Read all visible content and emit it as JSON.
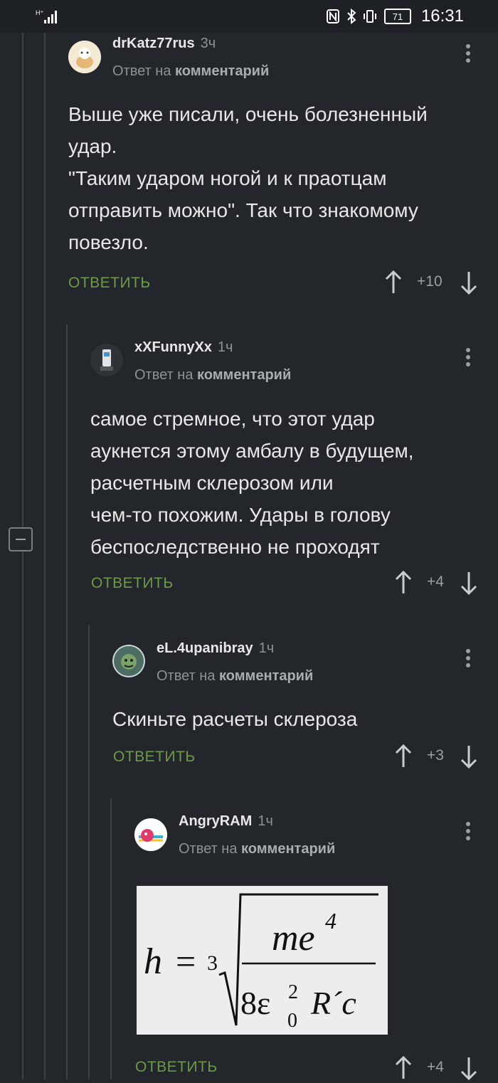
{
  "status_bar": {
    "time": "16:31",
    "battery": "71",
    "network": "H⁺"
  },
  "comments": [
    {
      "username": "drKatz77rus",
      "time": "3ч",
      "reply_prefix": "Ответ на",
      "reply_target": "комментарий",
      "lines": [
        "Выше уже писали, очень болезненный",
        "удар.",
        "\"Таким ударом ногой и к праотцам",
        "отправить можно\". Так что знакомому",
        "повезло."
      ],
      "reply_label": "ОТВЕТИТЬ",
      "score": "+10"
    },
    {
      "username": "xXFunnyXx",
      "time": "1ч",
      "reply_prefix": "Ответ на",
      "reply_target": "комментарий",
      "lines": [
        "самое стремное, что этот удар",
        "аукнется этому амбалу в будущем,",
        "расчетным склерозом или",
        "чем-то похожим. Удары в голову",
        "беспоследственно не проходят"
      ],
      "reply_label": "ОТВЕТИТЬ",
      "score": "+4"
    },
    {
      "username": "eL.4upanibray",
      "time": "1ч",
      "reply_prefix": "Ответ на",
      "reply_target": "комментарий",
      "lines": [
        "Скиньте расчеты склероза"
      ],
      "reply_label": "ОТВЕТИТЬ",
      "score": "+3"
    },
    {
      "username": "AngryRAM",
      "time": "1ч",
      "reply_prefix": "Ответ на",
      "reply_target": "комментарий",
      "formula": {
        "lhs": "h",
        "eq": "=",
        "root_index": "3",
        "numerator": "me",
        "numerator_exp": "4",
        "den_coef": "8ε",
        "den_sub": "0",
        "den_sup": "2",
        "den_rest": "R´c"
      },
      "reply_label": "ОТВЕТИТЬ",
      "score": "+4"
    }
  ]
}
